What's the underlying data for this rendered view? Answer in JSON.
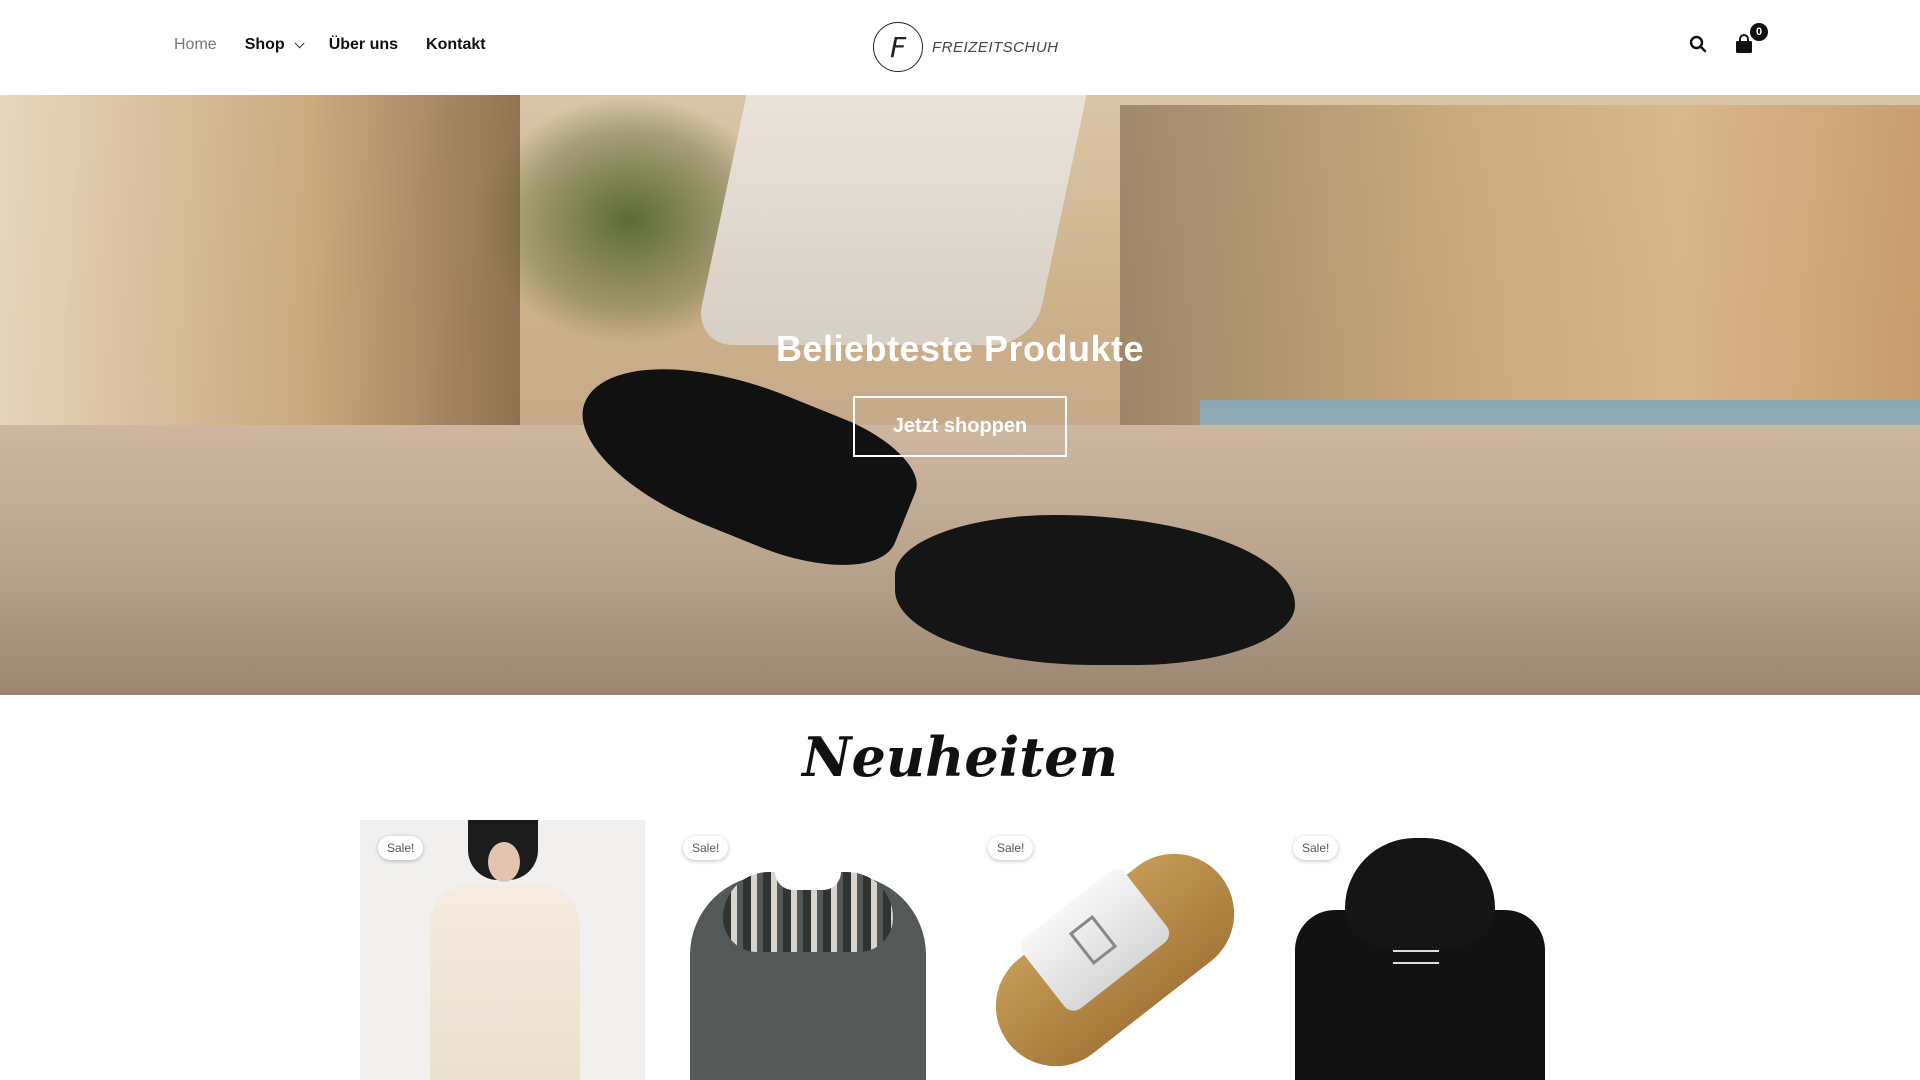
{
  "nav": {
    "items": [
      {
        "label": "Home",
        "active": true
      },
      {
        "label": "Shop",
        "has_dropdown": true
      },
      {
        "label": "Über uns"
      },
      {
        "label": "Kontakt"
      }
    ]
  },
  "logo": {
    "letter": "F",
    "text": "FREIZEITSCHUH"
  },
  "header_icons": {
    "search": "search-icon",
    "cart": "shopping-bag-icon",
    "cart_count": "0"
  },
  "hero": {
    "title": "Beliebteste Produkte",
    "button_label": "Jetzt shoppen"
  },
  "new_section": {
    "title": "Neuheiten",
    "products": [
      {
        "badge": "Sale!",
        "image": "white-turtleneck-sweater-dress"
      },
      {
        "badge": "Sale!",
        "image": "grey-nordic-knit-sweater"
      },
      {
        "badge": "Sale!",
        "image": "white-buckle-sandal"
      },
      {
        "badge": "Sale!",
        "image": "black-hoodie"
      }
    ]
  }
}
